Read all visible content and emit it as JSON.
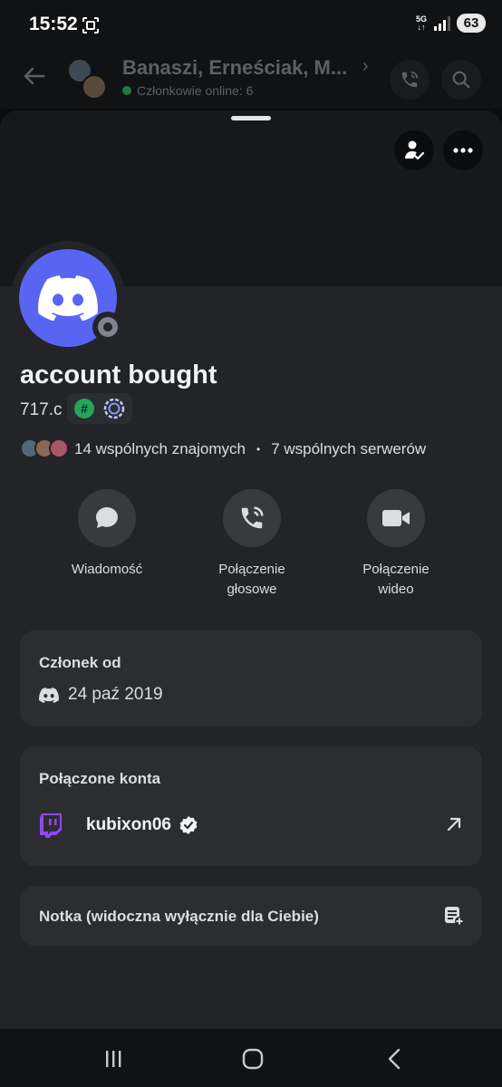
{
  "status_bar": {
    "time": "15:52",
    "network_top": "5G",
    "network_bottom": "↓↑",
    "battery": "63",
    "icons": [
      "screenshot-icon",
      "signal-icon"
    ]
  },
  "chat_header": {
    "title": "Banaszi, Erneściak, M...",
    "online_text": "Członkowie online: 6",
    "online_color": "#23a55a",
    "icons": [
      "back-arrow-icon",
      "chevron-right-icon",
      "phone-call-icon",
      "search-icon"
    ]
  },
  "profile": {
    "display_name": "account bought",
    "username": "717.c",
    "avatar_color": "#5865f2",
    "badges": [
      "hashtag-badge",
      "nitro-badge"
    ],
    "mutual_friends": "14 wspólnych znajomych",
    "separator": "•",
    "mutual_servers": "7 wspólnych serwerów",
    "top_icons": [
      "add-friend-icon",
      "more-icon"
    ]
  },
  "actions": [
    {
      "label": "Wiadomość",
      "icon": "chat-bubble-icon"
    },
    {
      "label": "Połączenie\ngłosowe",
      "icon": "phone-icon"
    },
    {
      "label": "Połączenie\nwideo",
      "icon": "video-camera-icon"
    }
  ],
  "member_since": {
    "title": "Członek od",
    "date": "24 paź 2019"
  },
  "connected_accounts": {
    "title": "Połączone konta",
    "accounts": [
      {
        "service": "Twitch",
        "name": "kubixon06",
        "verified": true,
        "brand_color": "#9146ff"
      }
    ]
  },
  "note": {
    "label": "Notka (widoczna wyłącznie dla Ciebie)"
  },
  "colors": {
    "background": "#232428",
    "card": "#2b2d31",
    "blurple": "#5865f2"
  }
}
